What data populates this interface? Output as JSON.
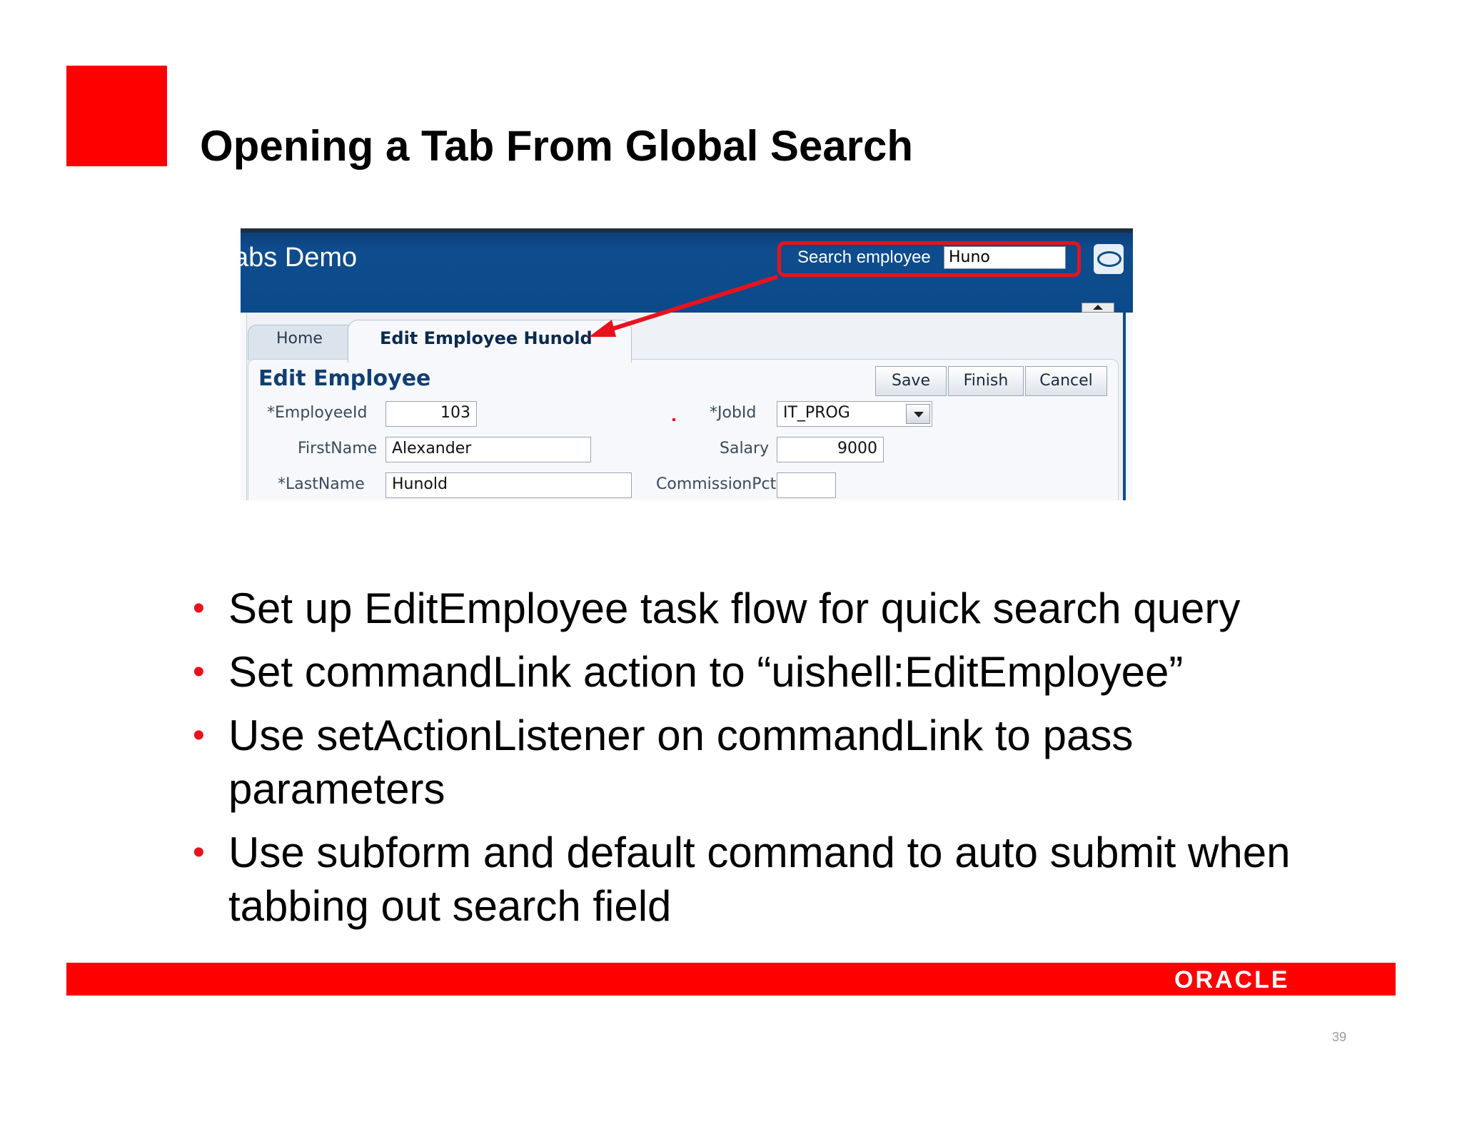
{
  "slide": {
    "title": "Opening a Tab From Global Search",
    "bullets": [
      "Set up EditEmployee task flow for quick search query",
      "Set commandLink action to “uishell:EditEmployee”",
      "Use setActionListener on commandLink to pass parameters",
      "Use subform and default command to auto submit when tabbing out search field"
    ],
    "footer_logo": "ORACLE",
    "page_number": "39"
  },
  "app": {
    "title": "abs Demo",
    "search": {
      "label": "Search employee",
      "value": "Huno"
    },
    "tabs": [
      {
        "label": "Home",
        "active": false
      },
      {
        "label": "Edit Employee Hunold",
        "active": true
      }
    ],
    "form": {
      "title": "Edit Employee",
      "buttons": [
        "Save",
        "Finish",
        "Cancel"
      ],
      "fields": {
        "employee_id": {
          "label": "EmployeeId",
          "value": "103",
          "required": true
        },
        "first_name": {
          "label": "FirstName",
          "value": "Alexander",
          "required": false
        },
        "last_name": {
          "label": "LastName",
          "value": "Hunold",
          "required": true
        },
        "job_id": {
          "label": "JobId",
          "value": "IT_PROG",
          "required": true
        },
        "salary": {
          "label": "Salary",
          "value": "9000",
          "required": false
        },
        "commission_pct": {
          "label": "CommissionPct",
          "value": "",
          "required": false
        }
      },
      "required_marker": "*"
    }
  },
  "colors": {
    "oracle_red": "#ff0000",
    "header_blue": "#0e4c8e",
    "highlight_red": "#e8121c"
  }
}
